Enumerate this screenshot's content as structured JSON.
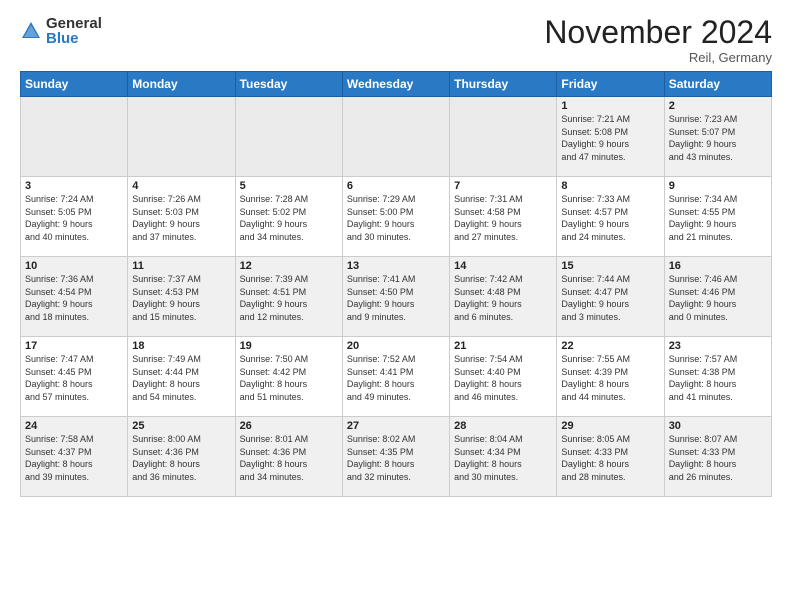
{
  "logo": {
    "general": "General",
    "blue": "Blue"
  },
  "header": {
    "month": "November 2024",
    "location": "Reil, Germany"
  },
  "weekdays": [
    "Sunday",
    "Monday",
    "Tuesday",
    "Wednesday",
    "Thursday",
    "Friday",
    "Saturday"
  ],
  "weeks": [
    [
      {
        "day": "",
        "info": ""
      },
      {
        "day": "",
        "info": ""
      },
      {
        "day": "",
        "info": ""
      },
      {
        "day": "",
        "info": ""
      },
      {
        "day": "",
        "info": ""
      },
      {
        "day": "1",
        "info": "Sunrise: 7:21 AM\nSunset: 5:08 PM\nDaylight: 9 hours\nand 47 minutes."
      },
      {
        "day": "2",
        "info": "Sunrise: 7:23 AM\nSunset: 5:07 PM\nDaylight: 9 hours\nand 43 minutes."
      }
    ],
    [
      {
        "day": "3",
        "info": "Sunrise: 7:24 AM\nSunset: 5:05 PM\nDaylight: 9 hours\nand 40 minutes."
      },
      {
        "day": "4",
        "info": "Sunrise: 7:26 AM\nSunset: 5:03 PM\nDaylight: 9 hours\nand 37 minutes."
      },
      {
        "day": "5",
        "info": "Sunrise: 7:28 AM\nSunset: 5:02 PM\nDaylight: 9 hours\nand 34 minutes."
      },
      {
        "day": "6",
        "info": "Sunrise: 7:29 AM\nSunset: 5:00 PM\nDaylight: 9 hours\nand 30 minutes."
      },
      {
        "day": "7",
        "info": "Sunrise: 7:31 AM\nSunset: 4:58 PM\nDaylight: 9 hours\nand 27 minutes."
      },
      {
        "day": "8",
        "info": "Sunrise: 7:33 AM\nSunset: 4:57 PM\nDaylight: 9 hours\nand 24 minutes."
      },
      {
        "day": "9",
        "info": "Sunrise: 7:34 AM\nSunset: 4:55 PM\nDaylight: 9 hours\nand 21 minutes."
      }
    ],
    [
      {
        "day": "10",
        "info": "Sunrise: 7:36 AM\nSunset: 4:54 PM\nDaylight: 9 hours\nand 18 minutes."
      },
      {
        "day": "11",
        "info": "Sunrise: 7:37 AM\nSunset: 4:53 PM\nDaylight: 9 hours\nand 15 minutes."
      },
      {
        "day": "12",
        "info": "Sunrise: 7:39 AM\nSunset: 4:51 PM\nDaylight: 9 hours\nand 12 minutes."
      },
      {
        "day": "13",
        "info": "Sunrise: 7:41 AM\nSunset: 4:50 PM\nDaylight: 9 hours\nand 9 minutes."
      },
      {
        "day": "14",
        "info": "Sunrise: 7:42 AM\nSunset: 4:48 PM\nDaylight: 9 hours\nand 6 minutes."
      },
      {
        "day": "15",
        "info": "Sunrise: 7:44 AM\nSunset: 4:47 PM\nDaylight: 9 hours\nand 3 minutes."
      },
      {
        "day": "16",
        "info": "Sunrise: 7:46 AM\nSunset: 4:46 PM\nDaylight: 9 hours\nand 0 minutes."
      }
    ],
    [
      {
        "day": "17",
        "info": "Sunrise: 7:47 AM\nSunset: 4:45 PM\nDaylight: 8 hours\nand 57 minutes."
      },
      {
        "day": "18",
        "info": "Sunrise: 7:49 AM\nSunset: 4:44 PM\nDaylight: 8 hours\nand 54 minutes."
      },
      {
        "day": "19",
        "info": "Sunrise: 7:50 AM\nSunset: 4:42 PM\nDaylight: 8 hours\nand 51 minutes."
      },
      {
        "day": "20",
        "info": "Sunrise: 7:52 AM\nSunset: 4:41 PM\nDaylight: 8 hours\nand 49 minutes."
      },
      {
        "day": "21",
        "info": "Sunrise: 7:54 AM\nSunset: 4:40 PM\nDaylight: 8 hours\nand 46 minutes."
      },
      {
        "day": "22",
        "info": "Sunrise: 7:55 AM\nSunset: 4:39 PM\nDaylight: 8 hours\nand 44 minutes."
      },
      {
        "day": "23",
        "info": "Sunrise: 7:57 AM\nSunset: 4:38 PM\nDaylight: 8 hours\nand 41 minutes."
      }
    ],
    [
      {
        "day": "24",
        "info": "Sunrise: 7:58 AM\nSunset: 4:37 PM\nDaylight: 8 hours\nand 39 minutes."
      },
      {
        "day": "25",
        "info": "Sunrise: 8:00 AM\nSunset: 4:36 PM\nDaylight: 8 hours\nand 36 minutes."
      },
      {
        "day": "26",
        "info": "Sunrise: 8:01 AM\nSunset: 4:36 PM\nDaylight: 8 hours\nand 34 minutes."
      },
      {
        "day": "27",
        "info": "Sunrise: 8:02 AM\nSunset: 4:35 PM\nDaylight: 8 hours\nand 32 minutes."
      },
      {
        "day": "28",
        "info": "Sunrise: 8:04 AM\nSunset: 4:34 PM\nDaylight: 8 hours\nand 30 minutes."
      },
      {
        "day": "29",
        "info": "Sunrise: 8:05 AM\nSunset: 4:33 PM\nDaylight: 8 hours\nand 28 minutes."
      },
      {
        "day": "30",
        "info": "Sunrise: 8:07 AM\nSunset: 4:33 PM\nDaylight: 8 hours\nand 26 minutes."
      }
    ]
  ]
}
